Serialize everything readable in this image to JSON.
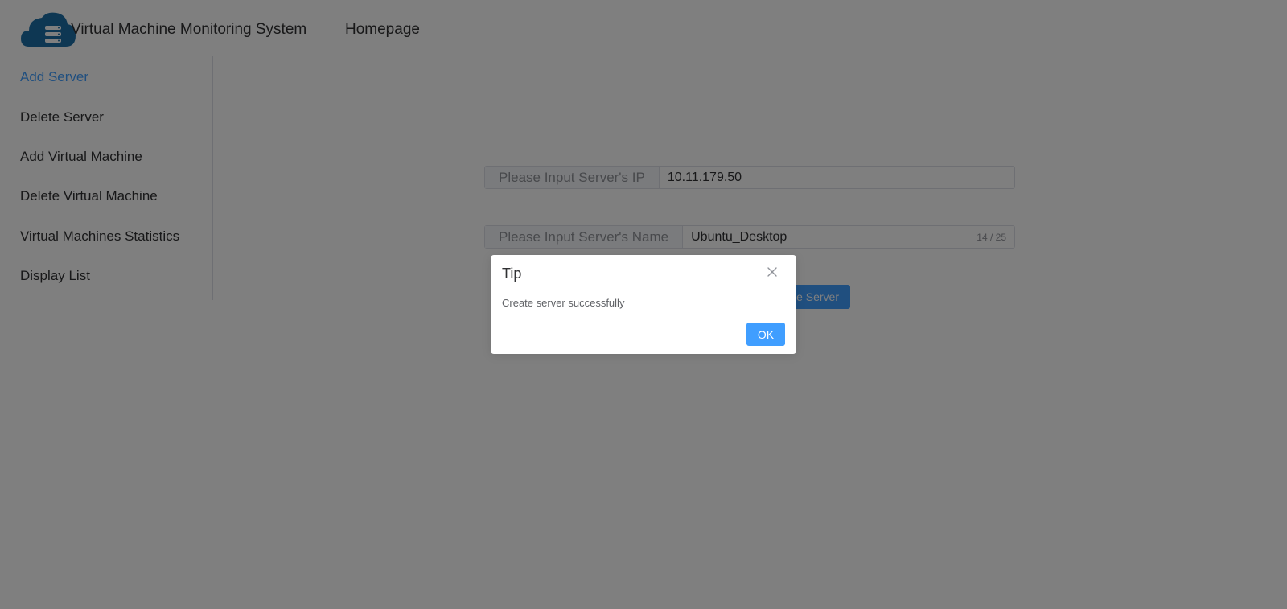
{
  "header": {
    "app_title": "Virtual Machine Monitoring System",
    "home_link": "Homepage",
    "logo_icon": "cloud-server-icon"
  },
  "sidebar": {
    "items": [
      {
        "label": "Add Server",
        "active": true
      },
      {
        "label": "Delete Server",
        "active": false
      },
      {
        "label": "Add Virtual Machine",
        "active": false
      },
      {
        "label": "Delete Virtual Machine",
        "active": false
      },
      {
        "label": "Virtual Machines Statistics",
        "active": false
      },
      {
        "label": "Display List",
        "active": false
      }
    ]
  },
  "form": {
    "ip_label": "Please Input Server's IP",
    "ip_value": "10.11.179.50",
    "name_label": "Please Input Server's Name",
    "name_value": "Ubuntu_Desktop",
    "name_count": "14 / 25",
    "create_button": "te Server"
  },
  "dialog": {
    "title": "Tip",
    "message": "Create server successfully",
    "ok_label": "OK",
    "close_icon": "close-icon"
  },
  "colors": {
    "accent": "#409eff",
    "overlay": "#00000080"
  }
}
